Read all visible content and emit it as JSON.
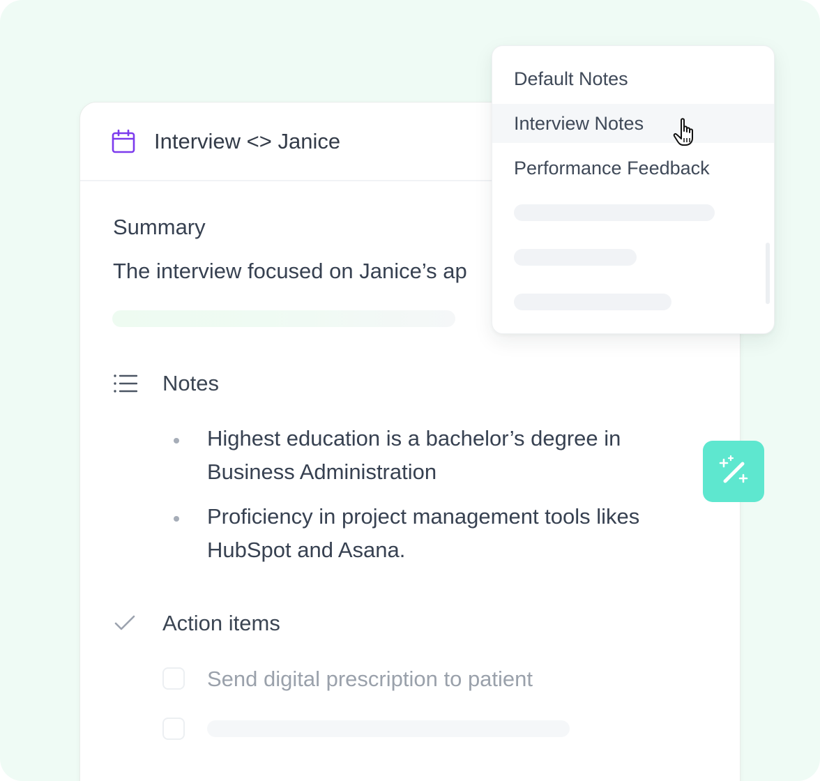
{
  "card": {
    "title": "Interview <> Janice",
    "summary": {
      "heading": "Summary",
      "text": "The interview focused on Janice’s ap"
    },
    "notes": {
      "heading": "Notes",
      "items": [
        "Highest education is a bachelor’s degree in Business Administration",
        "Proficiency in project management tools likes HubSpot and Asana."
      ]
    },
    "action_items": {
      "heading": "Action items",
      "items": [
        {
          "label": "Send digital prescription to patient",
          "checked": false
        },
        {
          "label": "",
          "checked": false
        }
      ]
    }
  },
  "dropdown": {
    "options": [
      "Default Notes",
      "Interview Notes",
      "Performance Feedback"
    ],
    "hovered": "Interview Notes"
  },
  "icons": {
    "header": "calendar-icon",
    "notes": "list-icon",
    "action_items": "check-icon",
    "magic": "magic-wand-icon",
    "cursor": "hand-pointer-icon"
  },
  "colors": {
    "background": "#effbf5",
    "accent_purple": "#7c3aed",
    "magic_button": "#5ee7cf",
    "text": "#374151",
    "muted_text": "#9aa1ab"
  }
}
